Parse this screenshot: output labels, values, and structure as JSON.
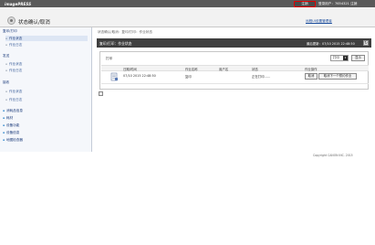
{
  "app": {
    "brand": "imagePRESS",
    "logout_label": "注销",
    "user_label": "登录用户：7654321 注销",
    "page_title": "状态确认/取消",
    "admin_link": "远程UI设置管理者"
  },
  "sidebar": {
    "groups": [
      {
        "label": "复印/打印",
        "items": [
          {
            "label": "作业状态",
            "active": true
          },
          {
            "label": "作业日志",
            "active": false
          }
        ]
      },
      {
        "label": "发送",
        "items": [
          {
            "label": "作业状态",
            "active": false
          },
          {
            "label": "作业日志",
            "active": false
          }
        ]
      },
      {
        "label": "接收",
        "items": [
          {
            "label": "作业状态",
            "active": false
          },
          {
            "label": "作业日志",
            "active": false
          }
        ]
      }
    ],
    "bottom_items": [
      "消耗品信息",
      "耗材",
      "设备功能",
      "设备信息",
      "地图检查器"
    ]
  },
  "main": {
    "breadcrumb": "状态确认/取消：复印/打印：作业状态",
    "section_title": "复印/打印：作业状态",
    "updated": "最后更新：07/10 2015 22:48:50",
    "refresh_icon": "refresh-icon"
  },
  "panel": {
    "label": "打印",
    "select_value": "打印",
    "show_button": "显示",
    "columns": [
      "日期/时间",
      "作业名称",
      "用户名",
      "状态",
      "作业操作"
    ],
    "rows": [
      {
        "icon": "document-icon",
        "datetime": "07/10 2015 22:48:50",
        "job_name": "复印",
        "user": "",
        "status": "正在打印……",
        "actions": {
          "cancel": "取消",
          "cancel_next": "取消下一个预约作业"
        }
      }
    ]
  },
  "footer": {
    "copyright": "Copyright CANON INC. 2015"
  },
  "colors": {
    "topbar": "#5a5a5a",
    "section_bar": "#3f3f3f",
    "link": "#1a4c9c",
    "logout_border": "#e00000"
  }
}
